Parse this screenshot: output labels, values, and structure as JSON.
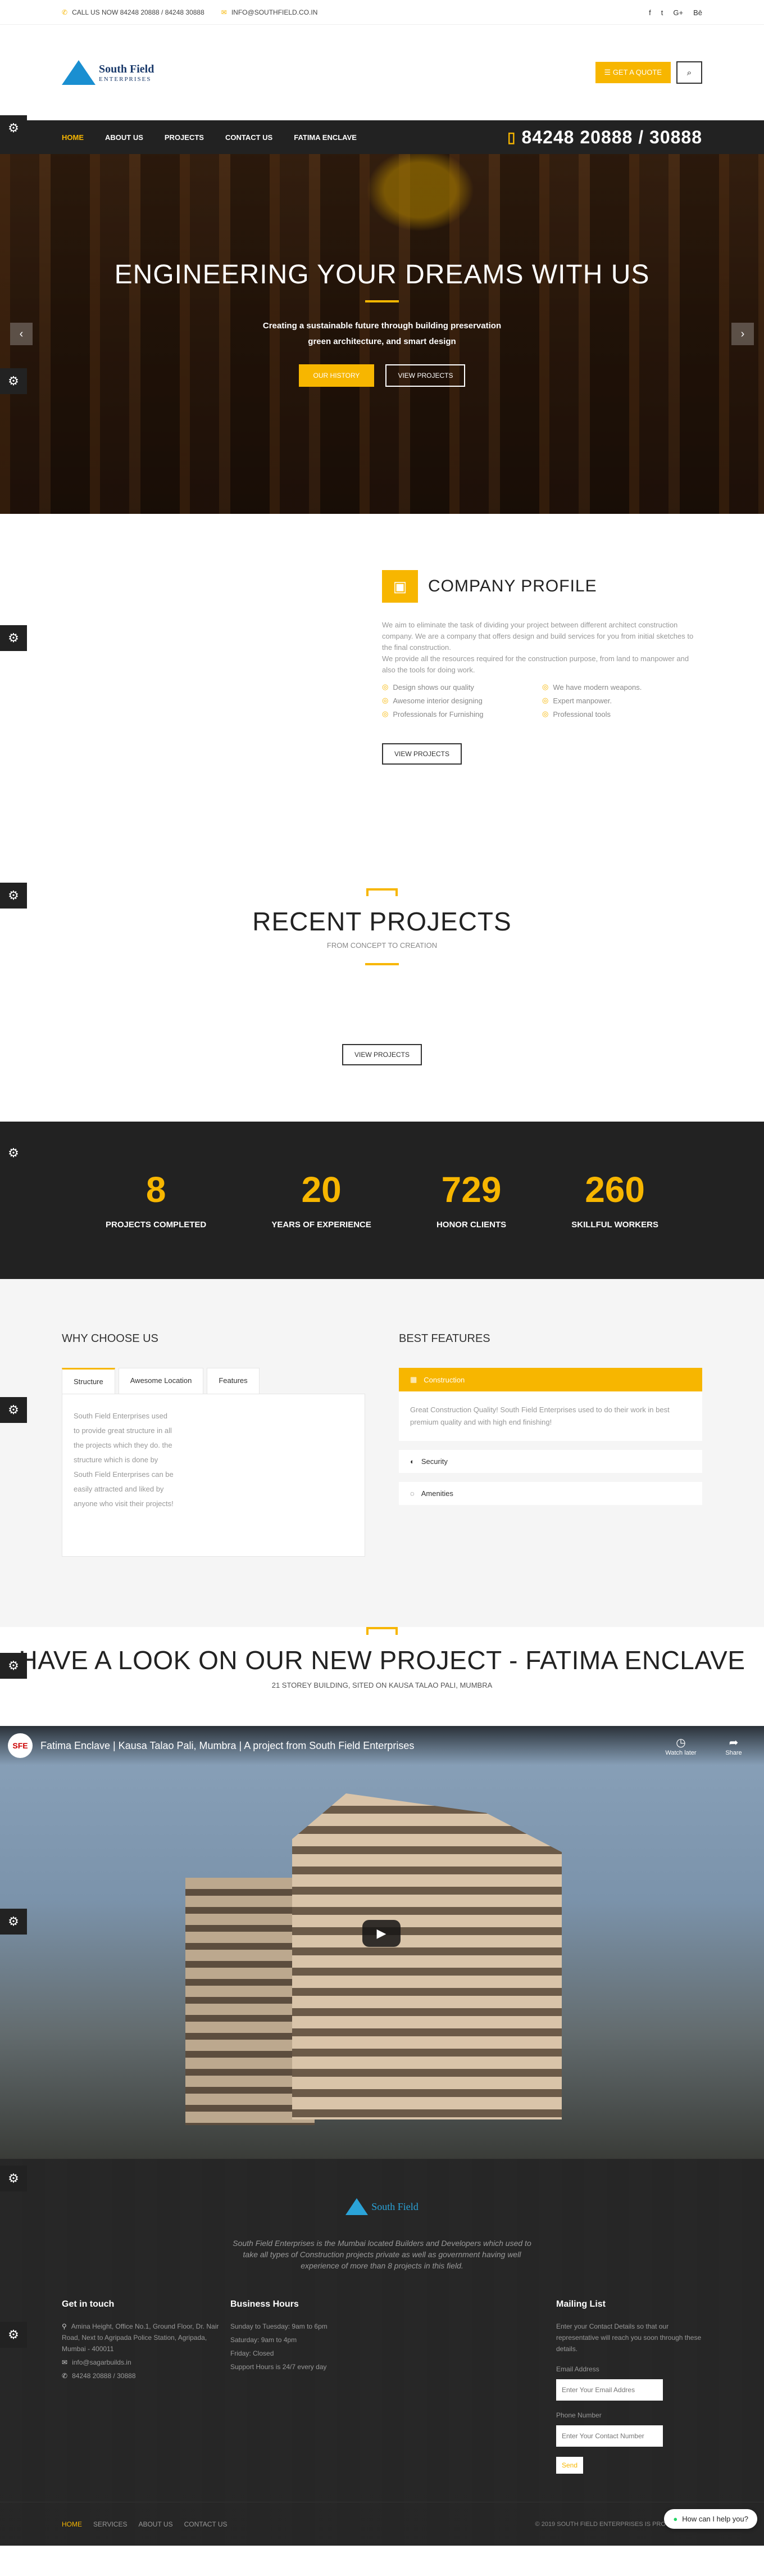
{
  "topbar": {
    "phone": "CALL US NOW 84248 20888 / 84248 30888",
    "email": "INFO@SOUTHFIELD.CO.IN",
    "socials": [
      "f",
      "t",
      "G+",
      "Bē"
    ]
  },
  "header": {
    "logo_name": "South Field",
    "logo_tag": "ENTERPRISES",
    "quote_label": "GET A QUOTE"
  },
  "nav": {
    "items": [
      "HOME",
      "ABOUT US",
      "PROJECTS",
      "CONTACT US",
      "FATIMA ENCLAVE"
    ],
    "phone": "84248 20888 / 30888"
  },
  "hero": {
    "title": "ENGINEERING YOUR DREAMS WITH US",
    "subtitle": "Creating a sustainable future through building preservation green architecture, and smart design",
    "btn_history": "OUR HISTORY",
    "btn_projects": "VIEW PROJECTS"
  },
  "profile": {
    "title": "COMPANY PROFILE",
    "text1": "We aim to eliminate the task of dividing your project between different architect construction company. We are a company that offers design and build services for you from initial sketches to the final construction.",
    "text2": "We provide all the resources required for the construction purpose, from land to manpower and also the tools for doing work.",
    "features": [
      "Design shows our quality",
      "We have modern weapons.",
      "Awesome interior designing",
      "Expert manpower.",
      "Professionals for Furnishing",
      "Professional tools"
    ],
    "button": "VIEW PROJECTS"
  },
  "recent": {
    "title": "RECENT PROJECTS",
    "subtitle": "FROM CONCEPT TO CREATION",
    "button": "VIEW PROJECTS"
  },
  "stats": [
    {
      "num": "8",
      "label": "PROJECTS COMPLETED"
    },
    {
      "num": "20",
      "label": "YEARS OF EXPERIENCE"
    },
    {
      "num": "729",
      "label": "HONOR CLIENTS"
    },
    {
      "num": "260",
      "label": "SKILLFUL WORKERS"
    }
  ],
  "why": {
    "title": "WHY CHOOSE US",
    "tabs": [
      "Structure",
      "Awesome Location",
      "Features"
    ],
    "panel_text": "South Field Enterprises used to provide great structure in all the projects which they do. the structure which is done by South Field Enterprises can be easily attracted and liked by anyone who visit their projects!"
  },
  "best": {
    "title": "BEST FEATURES",
    "items": [
      "Construction",
      "Security",
      "Amenities"
    ],
    "body": "Great Construction Quality! South Field Enterprises used to do their work in best premium quality and with high end finishing!"
  },
  "fatima": {
    "title": "HAVE A LOOK ON OUR NEW PROJECT - FATIMA ENCLAVE",
    "subtitle": "21 STOREY BUILDING, SITED ON KAUSA TALAO PALI, MUMBRA"
  },
  "video": {
    "badge": "SFE",
    "title": "Fatima Enclave | Kausa Talao Pali, Mumbra | A project from South Field Enterprises",
    "watch_later": "Watch later",
    "share": "Share"
  },
  "footer": {
    "logo": "South Field",
    "about": "South Field Enterprises is the Mumbai located Builders and Developers which used to take all types of Construction projects private as well as government having well experience of more than 8 projects in this field.",
    "touch_title": "Get in touch",
    "address": "Amina Height, Office No.1, Ground Floor, Dr. Nair Road, Next to Agripada Police Station, Agripada, Mumbai - 400011",
    "email": "info@sagarbuilds.in",
    "phone": "84248 20888 / 30888",
    "hours_title": "Business Hours",
    "hours": [
      "Sunday to Tuesday: 9am to 6pm",
      "Saturday: 9am to 4pm",
      "Friday: Closed",
      "Support Hours is 24/7 every day"
    ],
    "mail_title": "Mailing List",
    "mail_text": "Enter your Contact Details so that our representative will reach you soon through these details.",
    "email_label": "Email Address",
    "email_placeholder": "Enter Your Email Addres",
    "phone_label": "Phone Number",
    "phone_placeholder": "Enter Your Contact Number",
    "send": "Send",
    "links": [
      "HOME",
      "SERVICES",
      "ABOUT US",
      "CONTACT US"
    ],
    "copyright": "© 2019 SOUTH FIELD ENTERPRISES IS PROUDLY POWE",
    "help": "How can I help you?"
  }
}
